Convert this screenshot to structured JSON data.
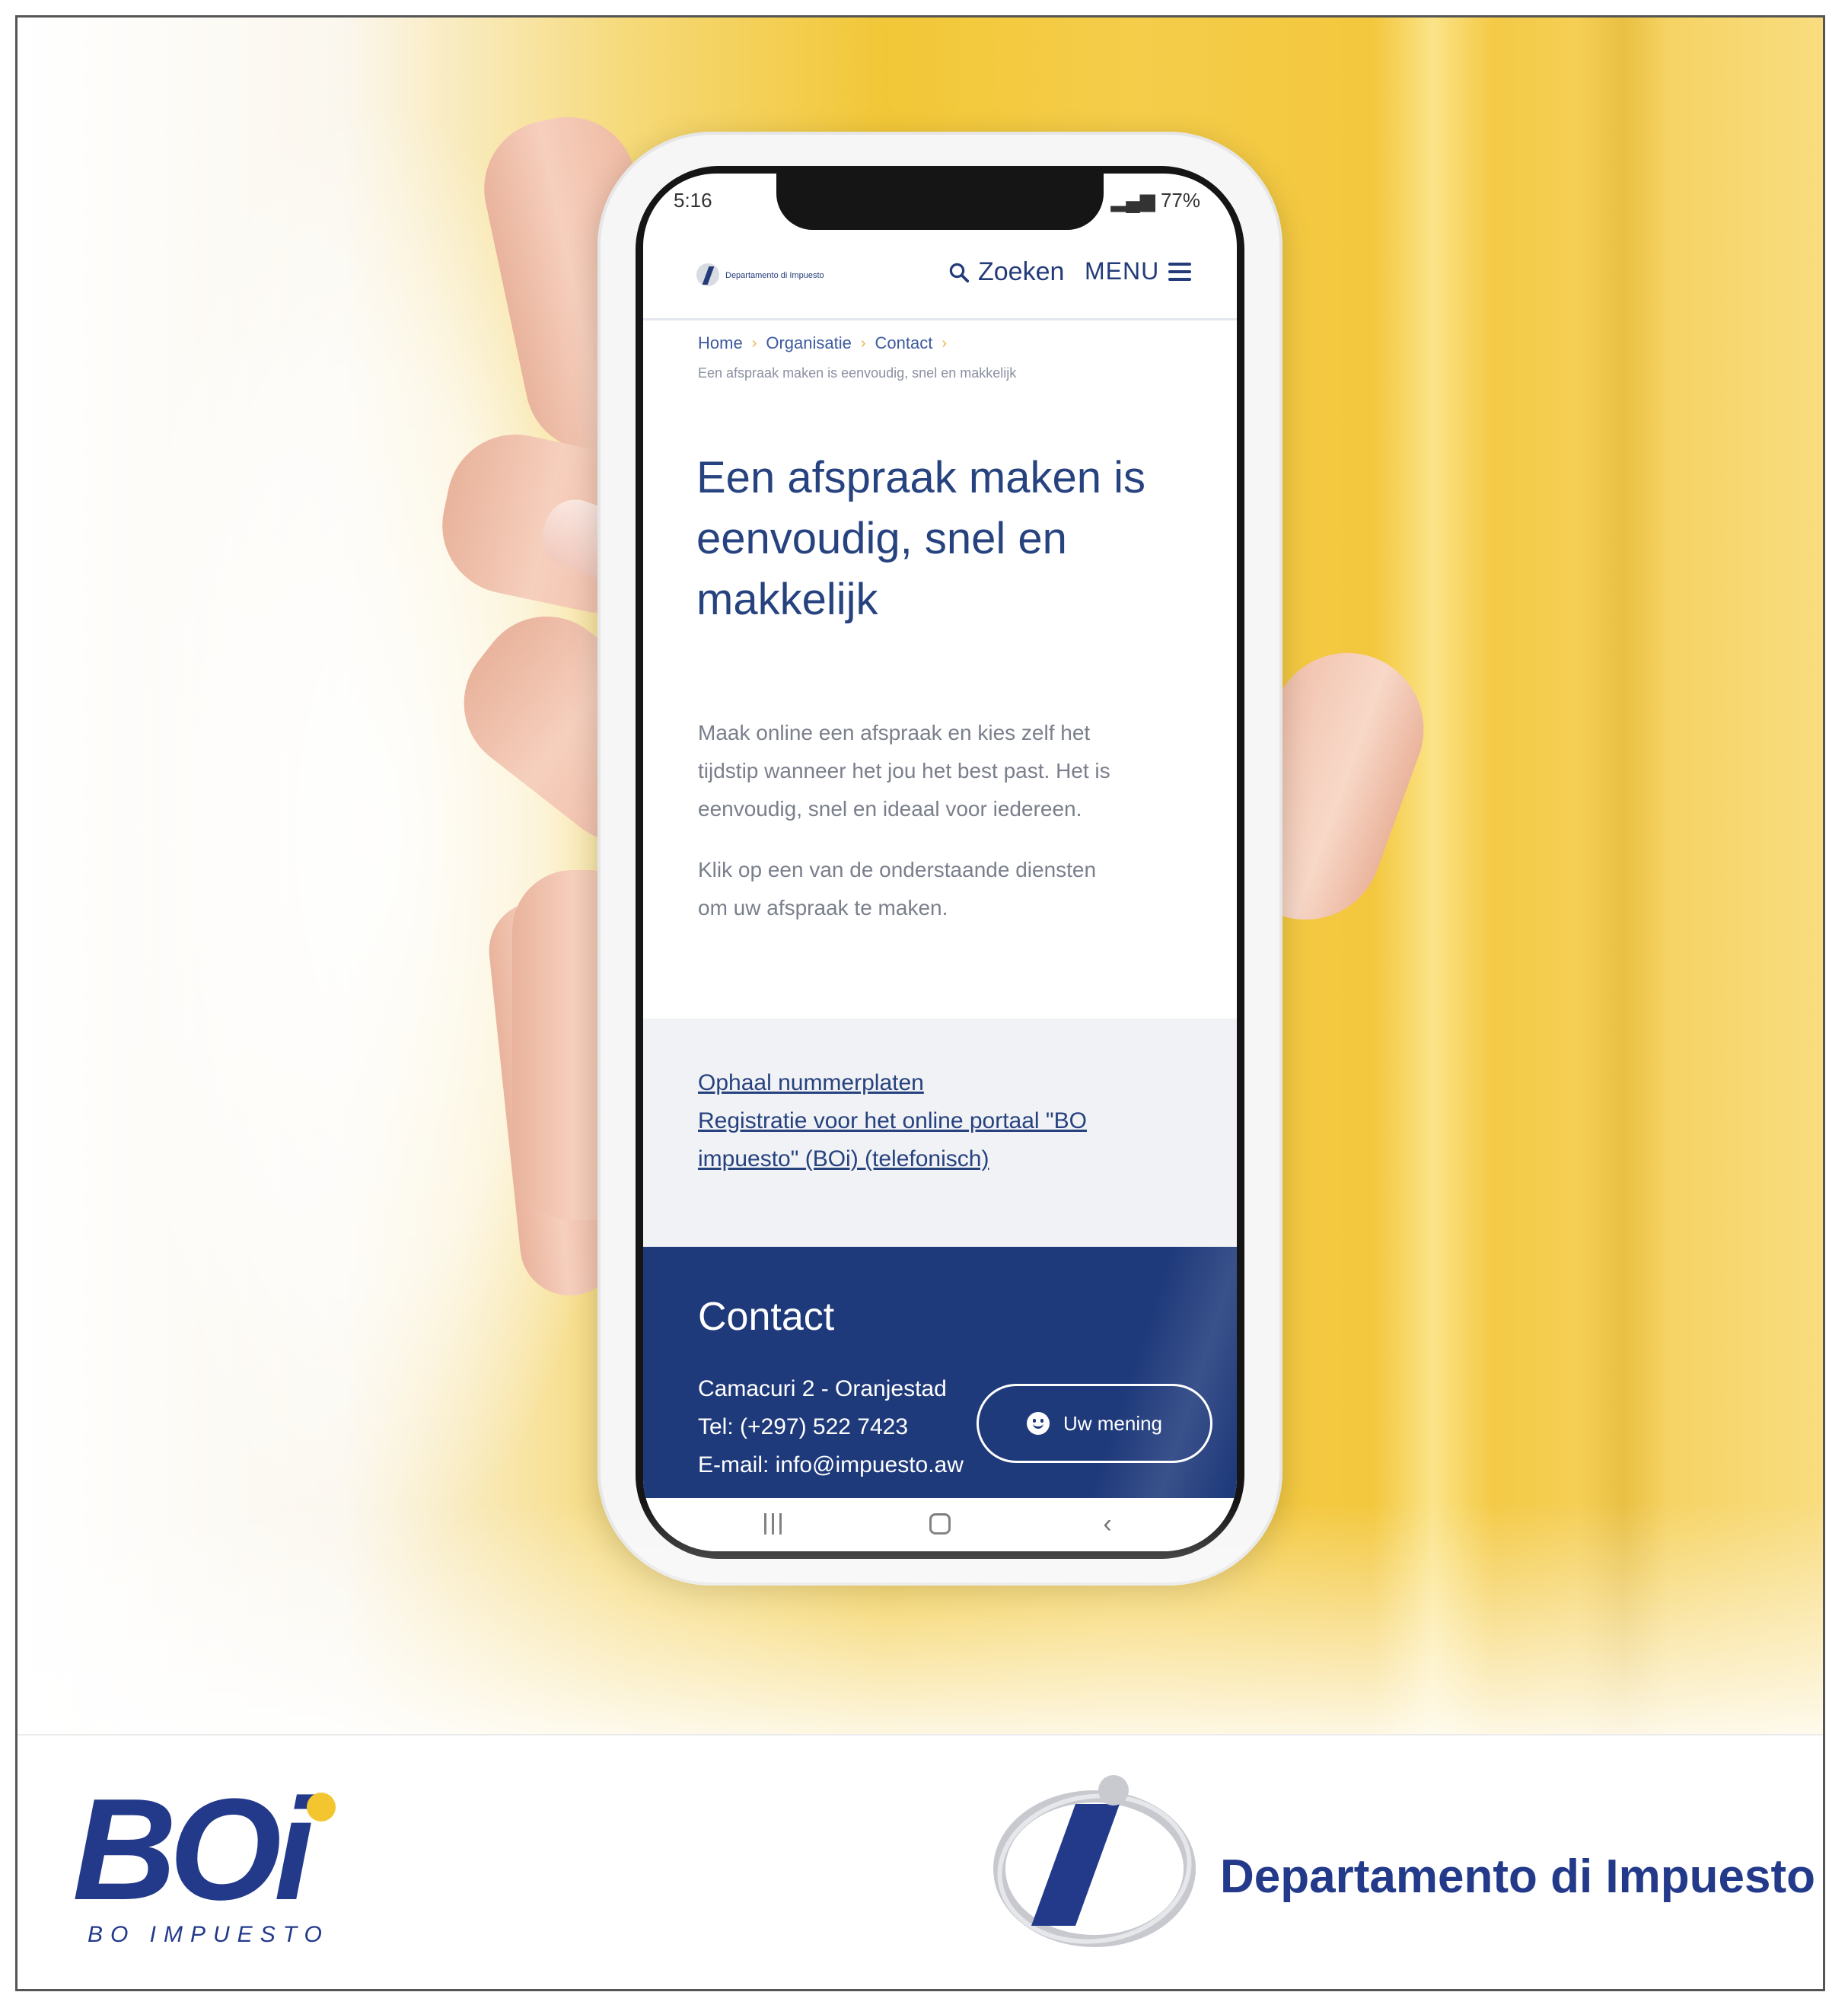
{
  "phone": {
    "status": {
      "time": "5:16",
      "battery": "77%"
    },
    "header": {
      "logo_text": "Departamento di Impuesto",
      "search_label": "Zoeken",
      "menu_label": "MENU"
    },
    "breadcrumb": {
      "items": [
        "Home",
        "Organisatie",
        "Contact"
      ],
      "current": "Een afspraak maken is eenvoudig, snel en makkelijk"
    },
    "title_lines": [
      "Een afspraak maken is",
      "eenvoudig, snel en",
      "makkelijk"
    ],
    "intro_lines": [
      "Maak online een afspraak en kies zelf het",
      "tijdstip wanneer het jou het best past. Het is",
      "eenvoudig, snel en ideaal voor iedereen."
    ],
    "instruction_lines": [
      "Klik op een van de onderstaande diensten",
      "om uw afspraak te maken."
    ],
    "services": {
      "link1": "Ophaal nummerplaten",
      "link2_line1": "Registratie voor het online portaal \"BO",
      "link2_line2": "impuesto\" (BOi) (telefonisch)"
    },
    "footer": {
      "title": "Contact",
      "address": "Camacuri 2 - Oranjestad",
      "phone": "Tel: (+297) 522 7423",
      "email": "E-mail: info@impuesto.aw",
      "feedback_label": "Uw mening"
    }
  },
  "logos": {
    "boi_word": "BOi",
    "boi_sub": "BO IMPUESTO",
    "department": "Departamento di Impuesto"
  },
  "colors": {
    "brand_blue": "#233a8b",
    "footer_blue": "#1f3a7b",
    "accent_yellow": "#f3c62f"
  }
}
